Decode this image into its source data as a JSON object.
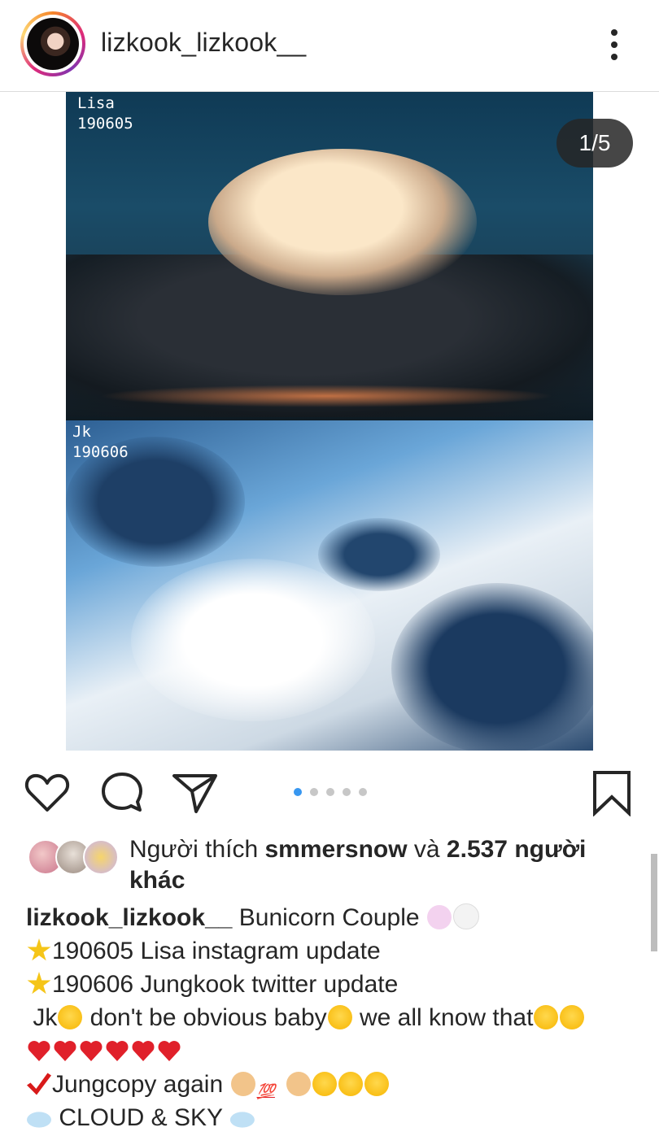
{
  "header": {
    "username": "lizkook_lizkook__",
    "avatar_icon": "profile-avatar",
    "more_icon": "more-vertical-icon"
  },
  "media": {
    "top_label": "Lisa\n190605",
    "bottom_label": "Jk\n190606",
    "counter": "1/5",
    "current_index": 1,
    "total": 5
  },
  "actions": {
    "like_icon": "heart-outline-icon",
    "comment_icon": "comment-icon",
    "share_icon": "paper-plane-icon",
    "save_icon": "bookmark-icon"
  },
  "likes": {
    "prefix": "Người thích ",
    "user": "smmersnow",
    "connector": " và ",
    "count": "2.537 người",
    "suffix": " khác"
  },
  "caption": {
    "author": "lizkook_lizkook__",
    "title": " Bunicorn Couple ",
    "line2": "190605 Lisa instagram update",
    "line3": "190606 Jungkook twitter update",
    "line4a": "Jk",
    "line4b": " don't be obvious baby",
    "line4c": " we all know that",
    "line6": "Jungcopy again ",
    "line7": " CLOUD & SKY ",
    "hundred": "💯"
  },
  "colors": {
    "accent": "#3897f0",
    "text": "#262626",
    "divider": "#dbdbdb"
  }
}
